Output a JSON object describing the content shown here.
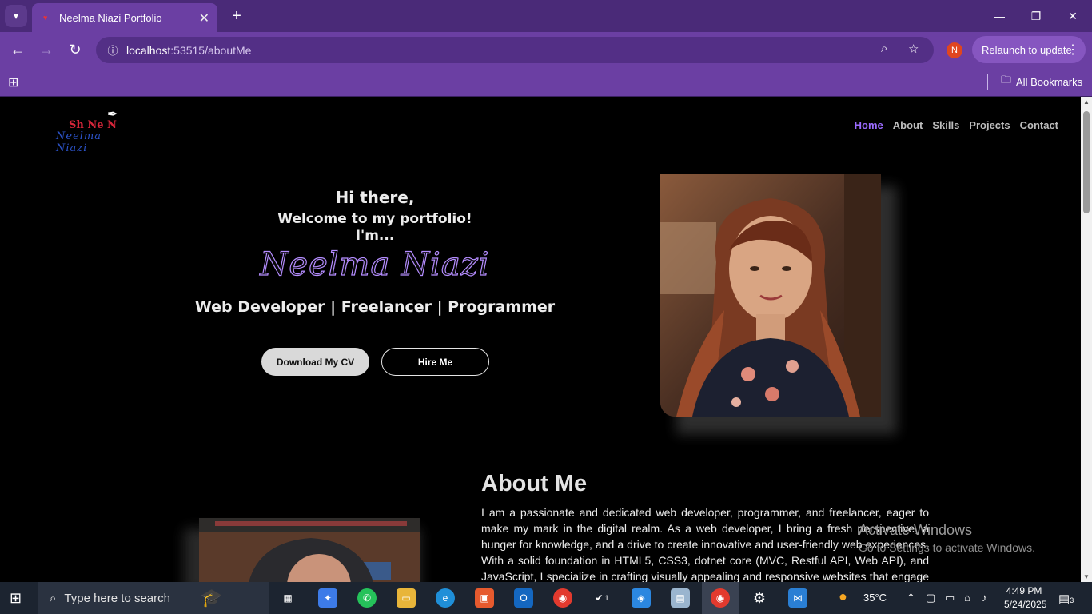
{
  "browser": {
    "tab_title": "Neelma Niazi Portfolio",
    "url_host": "localhost",
    "url_path": ":53515/aboutMe",
    "relaunch_label": "Relaunch to update",
    "profile_initial": "N",
    "bookmarks_label": "All Bookmarks"
  },
  "site": {
    "logo_line1": "Sh Ne N",
    "logo_line2": "Neelma Niazi",
    "nav": [
      "Home",
      "About",
      "Skills",
      "Projects",
      "Contact"
    ],
    "nav_active": "Home"
  },
  "hero": {
    "greeting": "Hi there,",
    "welcome": "Welcome to my portfolio!",
    "im": "I'm...",
    "name": "Neelma Niazi",
    "roles": "Web Developer | Freelancer | Programmer",
    "cv_button": "Download My CV",
    "hire_button": "Hire Me"
  },
  "about": {
    "heading": "About Me",
    "paragraph": "I am a passionate and dedicated web developer, programmer, and freelancer, eager to make my mark in the digital realm. As a web developer, I bring a fresh perspective, a hunger for knowledge, and a drive to create innovative and user-friendly web experiences. With a solid foundation in HTML5, CSS3, dotnet core (MVC, Restful API, Web API), and JavaScript, I specialize in crafting visually appealing and responsive websites that engage and captivate"
  },
  "watermark": {
    "line1": "Activate Windows",
    "line2": "Go to Settings to activate Windows."
  },
  "taskbar": {
    "search_placeholder": "Type here to search",
    "weather": "35°C",
    "time": "4:49 PM",
    "date": "5/24/2025",
    "notifications": "3",
    "badge_count": "1"
  },
  "colors": {
    "chrome_dark": "#4a2a78",
    "chrome": "#6b3fa3",
    "accent_purple": "#9b6bff",
    "page_bg": "#000000"
  }
}
